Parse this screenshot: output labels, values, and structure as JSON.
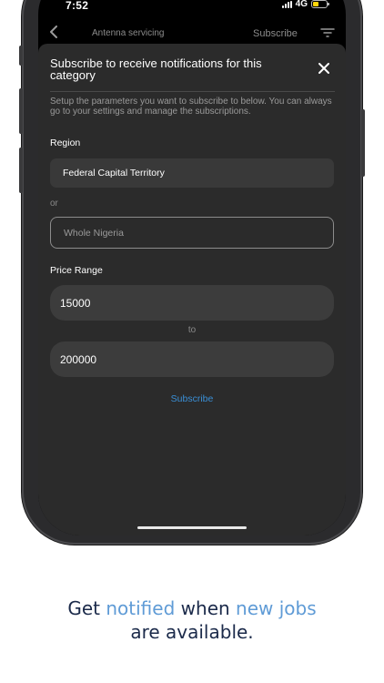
{
  "status_bar": {
    "time": "7:52",
    "network": "4G"
  },
  "app_header": {
    "title": "Antenna servicing",
    "subscribe_label": "Subscribe"
  },
  "sheet": {
    "title": "Subscribe to receive notifications for this category",
    "description": "Setup the parameters you want to subscribe to below. You can always go to your settings and manage the subscriptions.",
    "region_label": "Region",
    "region_value": "Federal Capital Territory",
    "or_text": "or",
    "alt_region_placeholder": "Whole Nigeria",
    "price_range_label": "Price Range",
    "price_min": "15000",
    "to_text": "to",
    "price_max": "200000",
    "subscribe_button": "Subscribe"
  },
  "caption": {
    "part1": "Get ",
    "part2": "notified",
    "part3": " when ",
    "part4": "new jobs",
    "part5": "are available."
  },
  "colors": {
    "sheet_background": "#2b2b2b",
    "link": "#3a8fd6",
    "caption_text": "#1b2a4a",
    "caption_accent": "#5f9bd6",
    "battery": "#ffd60a"
  },
  "icons": [
    "back-chevron-icon",
    "filter-icon",
    "close-icon",
    "signal-icon",
    "battery-icon"
  ]
}
